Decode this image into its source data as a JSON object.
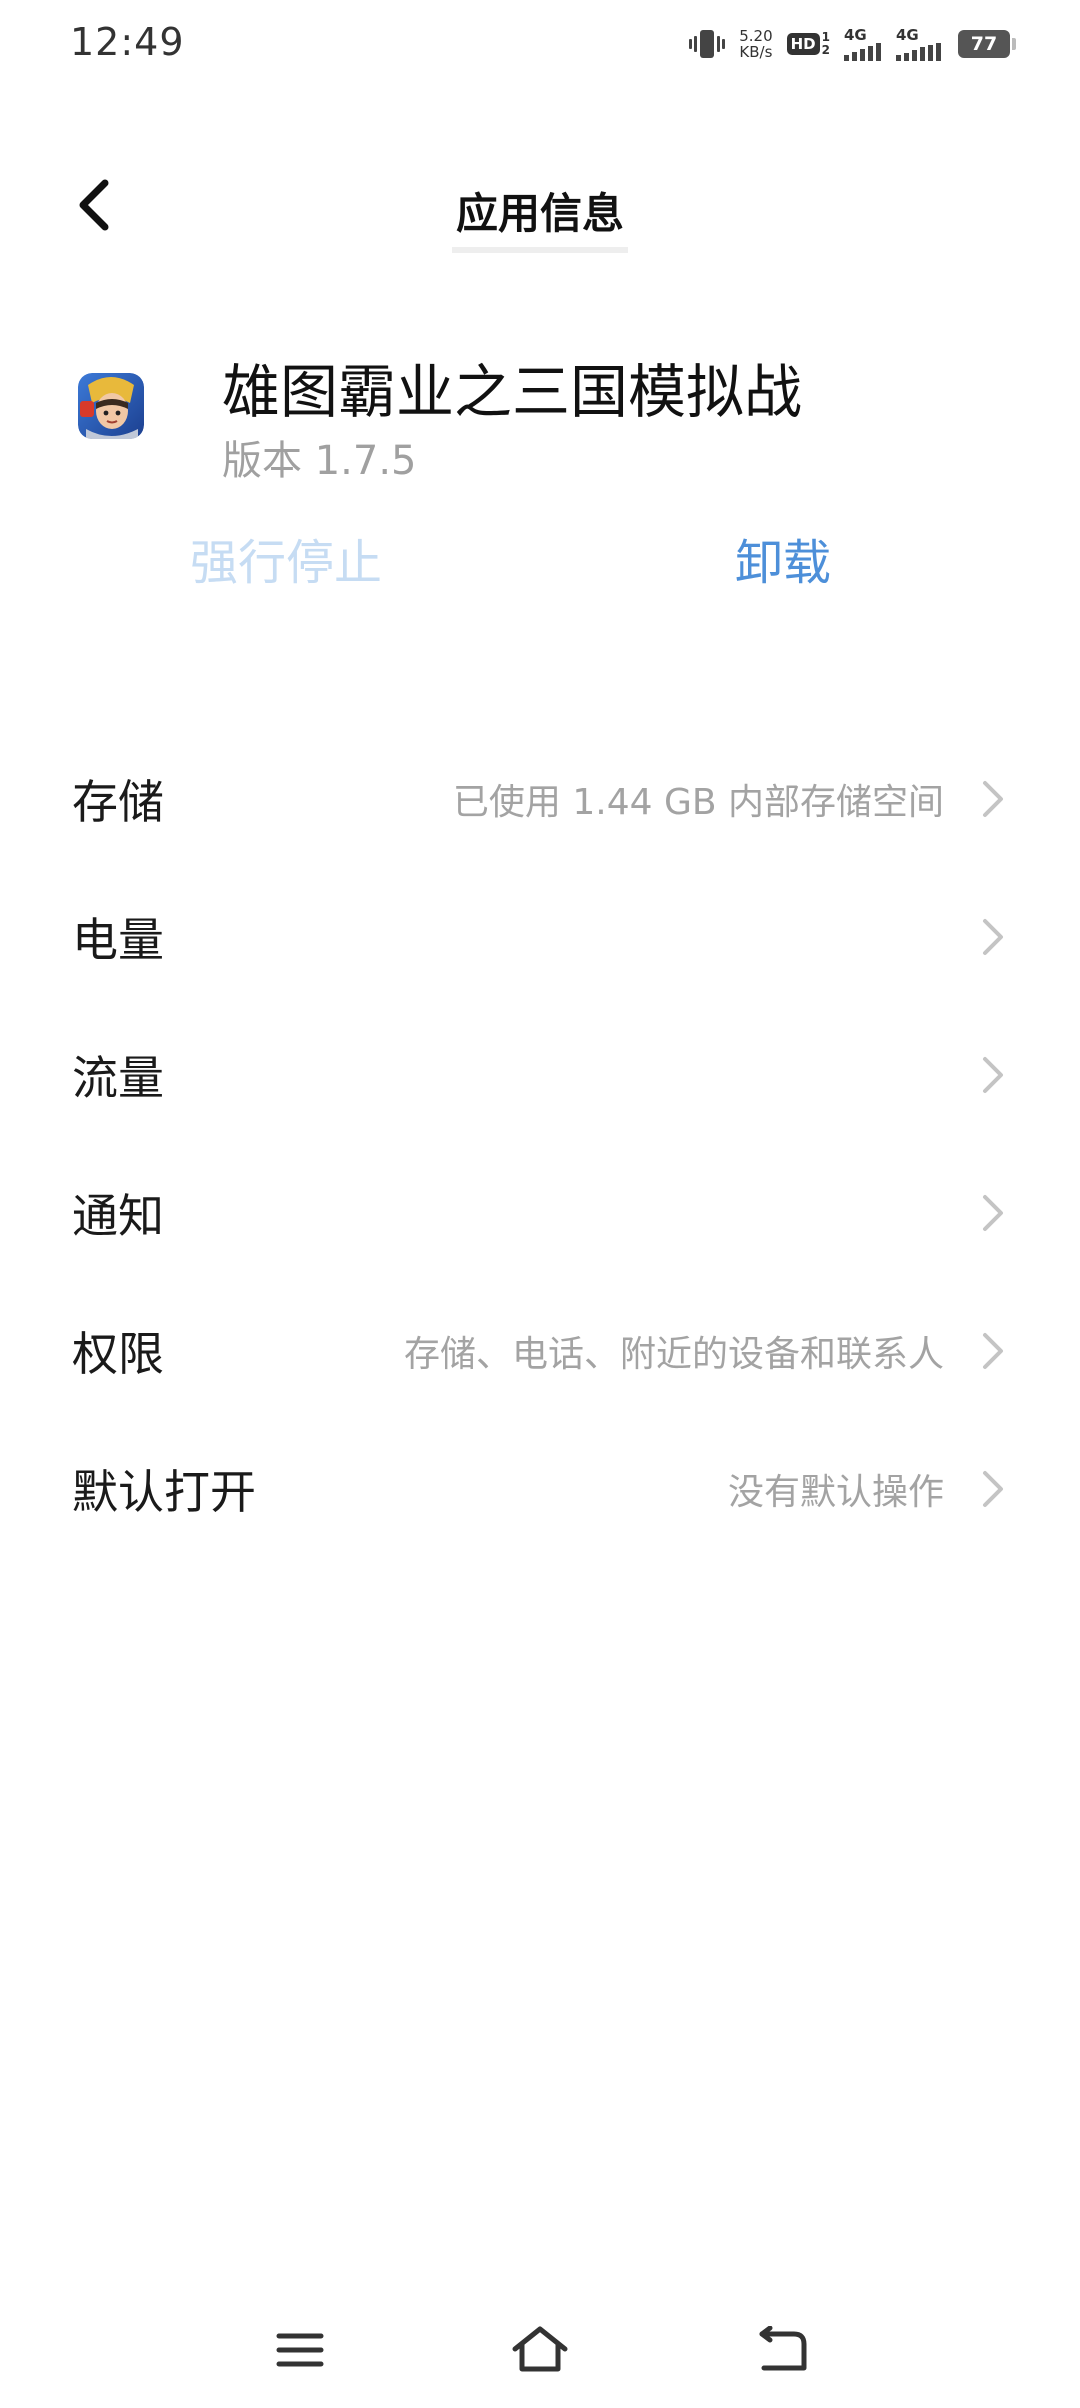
{
  "status_bar": {
    "time": "12:49",
    "net_speed_value": "5.20",
    "net_speed_unit": "KB/s",
    "hd_label": "HD",
    "hd_sub_top": "1",
    "hd_sub_bottom": "2",
    "signal1_label": "4G",
    "signal2_label": "4G",
    "battery": "77"
  },
  "header": {
    "title": "应用信息"
  },
  "app": {
    "name": "雄图霸业之三国模拟战",
    "version": "版本 1.7.5"
  },
  "actions": {
    "force_stop": "强行停止",
    "uninstall": "卸载"
  },
  "settings": [
    {
      "label": "存储",
      "value": "已使用 1.44 GB 内部存储空间"
    },
    {
      "label": "电量",
      "value": ""
    },
    {
      "label": "流量",
      "value": ""
    },
    {
      "label": "通知",
      "value": ""
    },
    {
      "label": "权限",
      "value": "存储、电话、附近的设备和联系人"
    },
    {
      "label": "默认打开",
      "value": "没有默认操作"
    }
  ],
  "colors": {
    "accent": "#4d8fd9",
    "disabled_accent": "#c6dcf3",
    "secondary_text": "#a3a3a3"
  }
}
